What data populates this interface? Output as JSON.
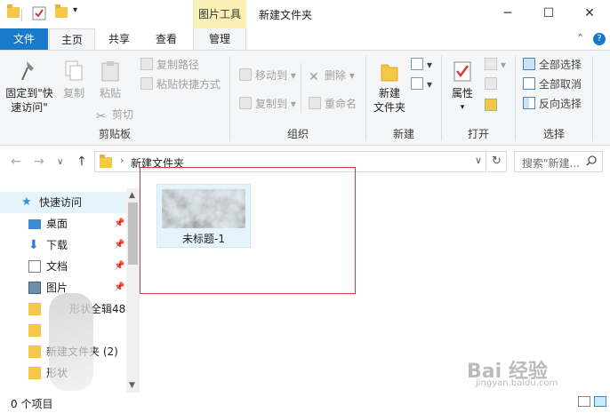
{
  "titlebar": {
    "contextual_tab": "图片工具",
    "window_title": "新建文件夹",
    "minimize": "─",
    "maximize": "☐",
    "close": "✕"
  },
  "tabs": {
    "file": "文件",
    "home": "主页",
    "share": "共享",
    "view": "查看",
    "manage": "管理",
    "collapse": "⌃",
    "help": "?"
  },
  "ribbon": {
    "clipboard": {
      "label": "剪贴板",
      "pin_line1": "固定到\"快",
      "pin_line2": "速访问\"",
      "copy": "复制",
      "paste": "粘贴",
      "copy_path": "复制路径",
      "paste_shortcut": "粘贴快捷方式",
      "cut": "剪切"
    },
    "organize": {
      "label": "组织",
      "move_to": "移动到",
      "copy_to": "复制到",
      "delete": "删除",
      "rename": "重命名"
    },
    "new": {
      "label": "新建",
      "new_folder_line1": "新建",
      "new_folder_line2": "文件夹"
    },
    "open": {
      "label": "打开",
      "properties": "属性"
    },
    "select": {
      "label": "选择",
      "select_all": "全部选择",
      "select_none": "全部取消",
      "invert": "反向选择"
    }
  },
  "address": {
    "path": "新建文件夹",
    "search_placeholder": "搜索\"新建...",
    "refresh": "↻",
    "dropdown": "∨"
  },
  "nav": {
    "back": "←",
    "forward": "→",
    "recent": "∨",
    "up": "↑",
    "items": [
      {
        "label": "快速访问"
      },
      {
        "label": "桌面"
      },
      {
        "label": "下载"
      },
      {
        "label": "文档"
      },
      {
        "label": "图片"
      },
      {
        "label": "形状全辑48"
      },
      {
        "label": ""
      },
      {
        "label": "新建文件夹 (2)"
      },
      {
        "label": "形状"
      }
    ]
  },
  "content": {
    "files": [
      {
        "name": "未标题-1"
      }
    ]
  },
  "status": {
    "item_count": "0 个项目"
  },
  "watermark": {
    "main": "Bai 经验",
    "sub": "jingyan.baidu.com"
  },
  "colors": {
    "accent": "#1979ca",
    "contextual": "#f8f0b4",
    "selection": "#e5f3fb",
    "highlight_frame": "#d9383a"
  }
}
